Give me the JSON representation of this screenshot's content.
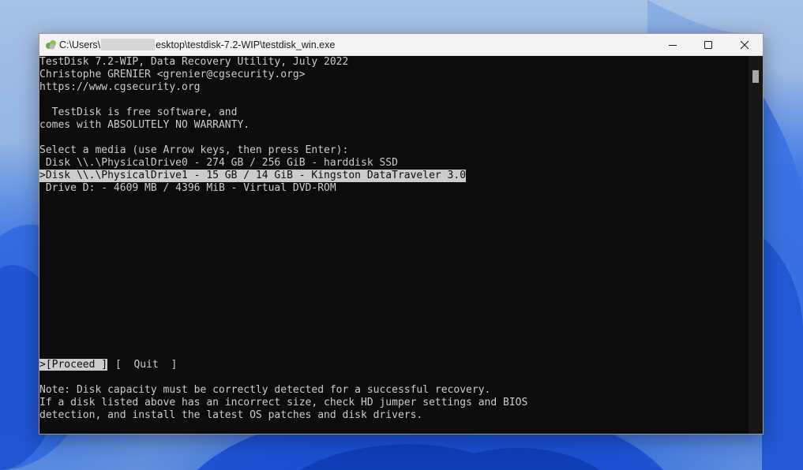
{
  "window": {
    "title_prefix": "C:\\Users\\",
    "title_suffix": "esktop\\testdisk-7.2-WIP\\testdisk_win.exe"
  },
  "header": {
    "line1": "TestDisk 7.2-WIP, Data Recovery Utility, July 2022",
    "line2": "Christophe GRENIER <grenier@cgsecurity.org>",
    "line3": "https://www.cgsecurity.org"
  },
  "license": {
    "line1": "  TestDisk is free software, and",
    "line2": "comes with ABSOLUTELY NO WARRANTY."
  },
  "media": {
    "prompt": "Select a media (use Arrow keys, then press Enter):",
    "items": [
      " Disk \\\\.\\PhysicalDrive0 - 274 GB / 256 GiB - harddisk SSD",
      ">Disk \\\\.\\PhysicalDrive1 - 15 GB / 14 GiB - Kingston DataTraveler 3.0",
      " Drive D: - 4609 MB / 4396 MiB - Virtual DVD-ROM"
    ],
    "selected_index": 1
  },
  "actions": {
    "proceed": ">[Proceed ]",
    "quit": "[  Quit  ]"
  },
  "note": {
    "line1": "Note: Disk capacity must be correctly detected for a successful recovery.",
    "line2": "If a disk listed above has an incorrect size, check HD jumper settings and BIOS",
    "line3": "detection, and install the latest OS patches and disk drivers."
  },
  "colors": {
    "console_bg": "#0c0c0c",
    "console_fg": "#cccccc",
    "selection_bg": "#cccccc"
  }
}
